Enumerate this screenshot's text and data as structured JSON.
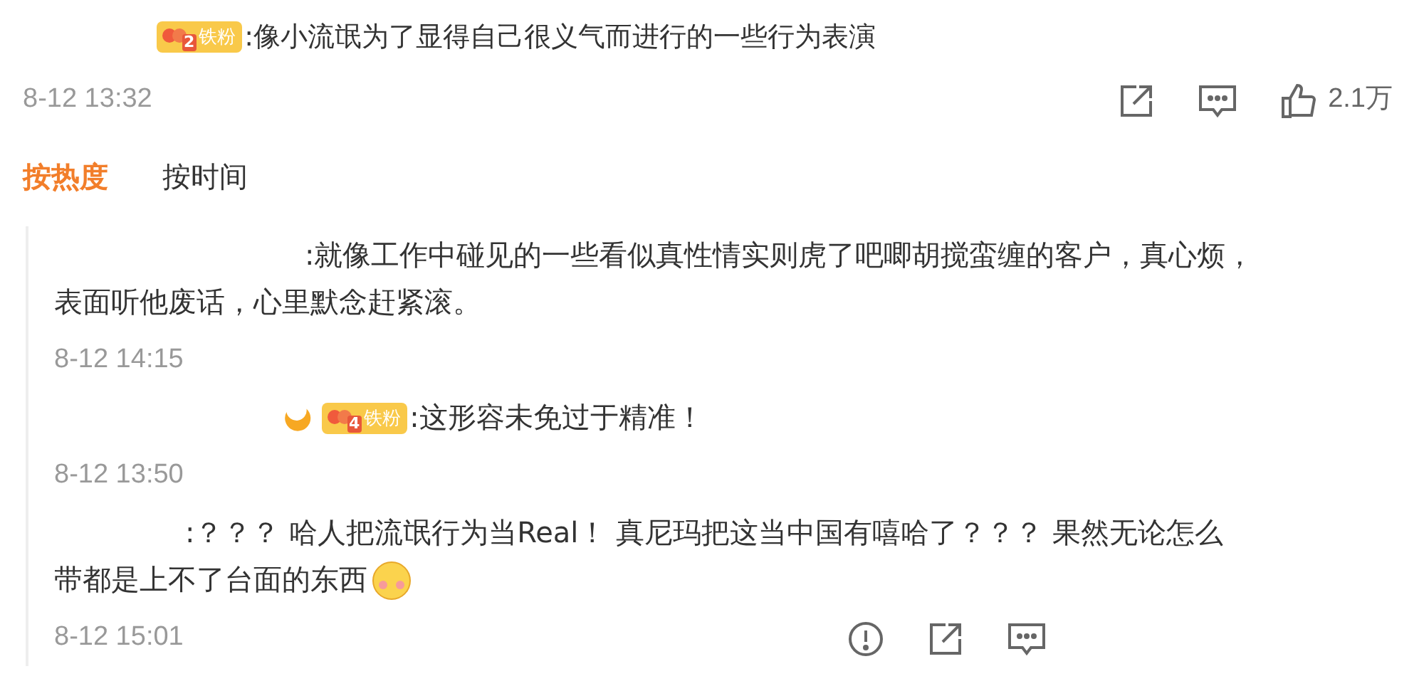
{
  "comment": {
    "badge": {
      "level": "2",
      "label": "铁粉"
    },
    "text": ":像小流氓为了显得自己很义气而进行的一些行为表演",
    "time": "8-12 13:32",
    "like_count": "2.1万"
  },
  "sort_tabs": [
    {
      "label": "按热度",
      "selected": true
    },
    {
      "label": "按时间",
      "selected": false
    }
  ],
  "replies": [
    {
      "member": false,
      "text": ":就像工作中碰见的一些看似真性情实则虎了吧唧胡搅蛮缠的客户，真心烦，表面听他废话，心里默念赶紧滚。",
      "time": "8-12 14:15",
      "show_actions": false
    },
    {
      "member": true,
      "badge": {
        "level": "4",
        "label": "铁粉"
      },
      "text": ":这形容未免过于精准！",
      "time": "8-12 13:50",
      "show_actions": false
    },
    {
      "member": false,
      "text": ":？？？ 哈人把流氓行为当Real！ 真尼玛把这当中国有嘻哈了？？？ 果然无论怎么带都是上不了台面的东西",
      "emoji": true,
      "time": "8-12 15:01",
      "show_actions": true
    }
  ]
}
